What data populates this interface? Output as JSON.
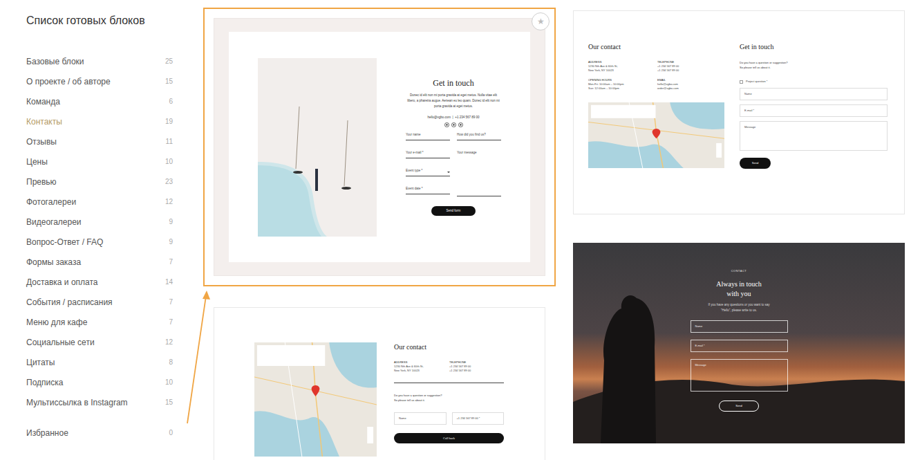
{
  "sidebar": {
    "title": "Список готовых блоков",
    "items": [
      {
        "label": "Базовые блоки",
        "count": "25",
        "selected": false
      },
      {
        "label": "О проекте / об авторе",
        "count": "15",
        "selected": false
      },
      {
        "label": "Команда",
        "count": "6",
        "selected": false
      },
      {
        "label": "Контакты",
        "count": "19",
        "selected": true
      },
      {
        "label": "Отзывы",
        "count": "11",
        "selected": false
      },
      {
        "label": "Цены",
        "count": "10",
        "selected": false
      },
      {
        "label": "Превью",
        "count": "23",
        "selected": false
      },
      {
        "label": "Фотогалереи",
        "count": "12",
        "selected": false
      },
      {
        "label": "Видеогалереи",
        "count": "9",
        "selected": false
      },
      {
        "label": "Вопрос-Ответ / FAQ",
        "count": "9",
        "selected": false
      },
      {
        "label": "Формы заказа",
        "count": "7",
        "selected": false
      },
      {
        "label": "Доставка и оплата",
        "count": "14",
        "selected": false
      },
      {
        "label": "События / расписания",
        "count": "7",
        "selected": false
      },
      {
        "label": "Меню для кафе",
        "count": "7",
        "selected": false
      },
      {
        "label": "Социальные сети",
        "count": "12",
        "selected": false
      },
      {
        "label": "Цитаты",
        "count": "8",
        "selected": false
      },
      {
        "label": "Подписка",
        "count": "10",
        "selected": false
      },
      {
        "label": "Мультиссылка в Instagram",
        "count": "15",
        "selected": false
      }
    ],
    "favorites": {
      "label": "Избранное",
      "count": "0",
      "selected": false
    }
  },
  "card_columns": [
    {
      "cards": [
        {
          "kind": "split-form",
          "highlighted": true,
          "star": "★",
          "title": "Get in touch",
          "text": "Donec id elit non mi porta gravida at eget metus. Nulla vitae elit libero, a pharetra augue. Aenean eu leo quam. Donec id elit non mi porta gravida at eget metus.",
          "contact": "hello@vgbo.com  |  +1 234 567 89 00",
          "fields_left": [
            {
              "label": "Your name",
              "kind": "input"
            },
            {
              "label": "Your e-mail *",
              "kind": "input"
            },
            {
              "label": "Event type *",
              "kind": "select"
            },
            {
              "label": "Event date *",
              "kind": "input"
            }
          ],
          "fields_right": [
            {
              "label": "How did you find us?",
              "kind": "input"
            },
            {
              "label": "Your message",
              "kind": "textarea"
            }
          ],
          "button": "Send form"
        },
        {
          "kind": "map-contact",
          "highlighted": false,
          "title": "Our contact",
          "info": [
            {
              "label": "ADDRESS",
              "lines": [
                "1230 Nth Ave & 60th St,",
                "New York, NY 10023"
              ]
            },
            {
              "label": "TELEPHONE",
              "lines": [
                "+1 234 567 89 00",
                "+1 234 567 89 00"
              ]
            }
          ],
          "text": [
            "Do you have a question or suggestion?",
            "So please tell us about it."
          ],
          "fields": [
            {
              "label": "Name",
              "kind": "input"
            },
            {
              "label": "+1 234 567 89 00 *",
              "kind": "input"
            }
          ],
          "button": "Call back"
        }
      ]
    },
    {
      "cards": [
        {
          "kind": "contact-map-form",
          "highlighted": false,
          "title": "Our contact",
          "info": [
            {
              "label": "ADDRESS",
              "lines": [
                "1230 Nth Ave & 60th St,",
                "New York, NY 10023"
              ]
            },
            {
              "label": "TELEPHONE",
              "lines": [
                "+1 234 567 89 00",
                "+1 234 567 89 00"
              ]
            },
            {
              "label": "OPENING HOURS",
              "lines": [
                "Mon-Fri: 10:00am – 10:00pm",
                "Sun: 12:00am – 10:00pm"
              ]
            },
            {
              "label": "EMAIL",
              "lines": [
                "hello@vgbo.com",
                "order@vgbo.com"
              ]
            }
          ],
          "form_title": "Get in touch",
          "form_text": [
            "Do you have a question or suggestion?",
            "So please tell us about it."
          ],
          "checkbox": {
            "label": "Project question *",
            "checked": false
          },
          "fields": [
            {
              "label": "Name",
              "kind": "input"
            },
            {
              "label": "E-mail *",
              "kind": "input"
            },
            {
              "label": "Message",
              "kind": "textarea"
            }
          ],
          "button": "Send"
        },
        {
          "kind": "photo-form",
          "highlighted": false,
          "eyebrow": "CONTACT",
          "title": [
            "Always in touch",
            "with you"
          ],
          "text": [
            "If you have any questions or you want to say",
            "\"Hello\", please write to us."
          ],
          "fields": [
            {
              "label": "Name",
              "kind": "input"
            },
            {
              "label": "E-mail *",
              "kind": "input"
            },
            {
              "label": "Message",
              "kind": "textarea"
            }
          ],
          "button": "Send"
        }
      ]
    }
  ]
}
